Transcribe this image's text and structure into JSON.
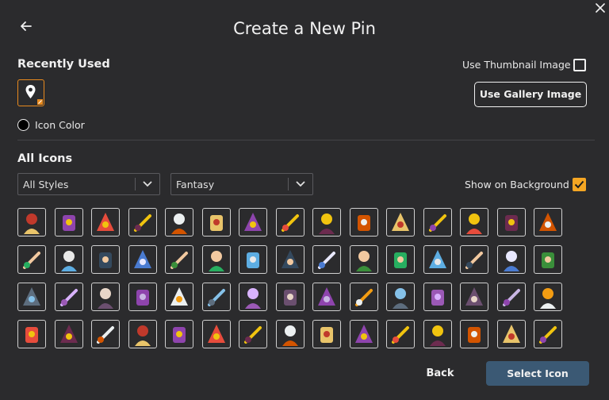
{
  "dialog": {
    "title": "Create a New Pin",
    "back_icon": "arrow-left-icon",
    "close_icon": "close-icon"
  },
  "recent": {
    "label": "Recently Used",
    "item_icon": "map-pin-icon",
    "icon_color_label": "Icon Color",
    "icon_color": "#000000"
  },
  "options": {
    "thumbnail_label": "Use Thumbnail Image",
    "thumbnail_checked": false,
    "gallery_button": "Use Gallery Image",
    "show_background_label": "Show on Background",
    "show_background_checked": true
  },
  "all_icons": {
    "label": "All Icons",
    "style_filter": "All Styles",
    "category_filter": "Fantasy"
  },
  "colors": {
    "accent": "#e88a1e",
    "checkbox": "#f5a623",
    "primary_button": "#3b5974",
    "background": "#2b2b2d"
  },
  "icons": [
    [
      "scroll-map-icon",
      "castle-icon",
      "crystal-icon",
      "dragon-egg-icon",
      "fairy-icon",
      "hooded-skull-icon",
      "king-icon",
      "medusa-icon",
      "spider-icon",
      "spellbook-icon",
      "sword-icon",
      "unicorn-icon",
      "viking-icon",
      "elf-woman-icon",
      "mountain-icon"
    ],
    [
      "tree-icon",
      "treasure-map-icon",
      "witch-icon",
      "potion-icon",
      "orc-icon",
      "dragon-icon",
      "knight-woman-icon",
      "coin-pouch-icon",
      "knight-helmet-icon",
      "roast-meat-icon",
      "elf-girl-icon",
      "fire-elemental-icon",
      "centaur-icon",
      "bow-icon",
      "armor-icon"
    ],
    [
      "candle-icon",
      "viking-warrior-icon",
      "dwarf-icon",
      "bearded-viking-icon",
      "dress-icon",
      "treasure-chest-icon",
      "crossed-swords-icon",
      "crossed-spears-icon",
      "skull-helmet-icon",
      "shield-icon",
      "sea-serpent-icon",
      "gallows-icon",
      "banner-shield-icon",
      "lute-icon",
      "adventurer-icon"
    ],
    [
      "warhammer-icon",
      "dagger-icon",
      "double-axe-icon",
      "quiver-icon",
      "ale-mug-icon",
      "paladin-icon",
      "goblet-icon",
      "goblin-icon",
      "hydra-icon",
      "crossbow-icon",
      "fortress-icon",
      "battle-axe-icon",
      "tome-icon",
      "horn-icon",
      "throne-icon"
    ]
  ],
  "footer": {
    "back_button": "Back",
    "select_button": "Select Icon"
  }
}
